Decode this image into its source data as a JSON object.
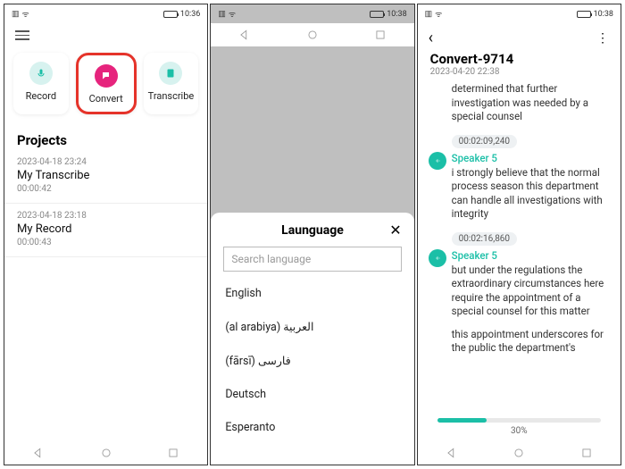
{
  "status": {
    "time1": "10:36",
    "time2": "10:38",
    "time3": "10:38"
  },
  "screen1": {
    "actions": {
      "record": "Record",
      "convert": "Convert",
      "transcribe": "Transcribe"
    },
    "section": "Projects",
    "projects": [
      {
        "date": "2023-04-18 23:24",
        "name": "My Transcribe",
        "dur": "00:00:42"
      },
      {
        "date": "2023-04-18 23:18",
        "name": "My Record",
        "dur": "00:00:43"
      }
    ]
  },
  "screen2": {
    "sheet_title": "Launguage",
    "search_placeholder": "Search language",
    "languages": [
      "English",
      "(al arabiya) العربية",
      "(fārsī) فارسی",
      "Deutsch",
      "Esperanto"
    ]
  },
  "screen3": {
    "title": "Convert-9714",
    "subtitle": "2023-04-20 22:38",
    "line0": "determined that further investigation was needed by a special counsel",
    "ts1": "00:02:09,240",
    "sp1": "Speaker 5",
    "ut1": "i strongly believe that the normal process season this department can handle all investigations with integrity",
    "ts2": "00:02:16,860",
    "sp2": "Speaker 5",
    "ut2": "but under the regulations the extraordinary circumstances here require the appointment of a special counsel for this matter",
    "cutoff": "this appointment underscores for the public the department's",
    "progress": "30%"
  }
}
